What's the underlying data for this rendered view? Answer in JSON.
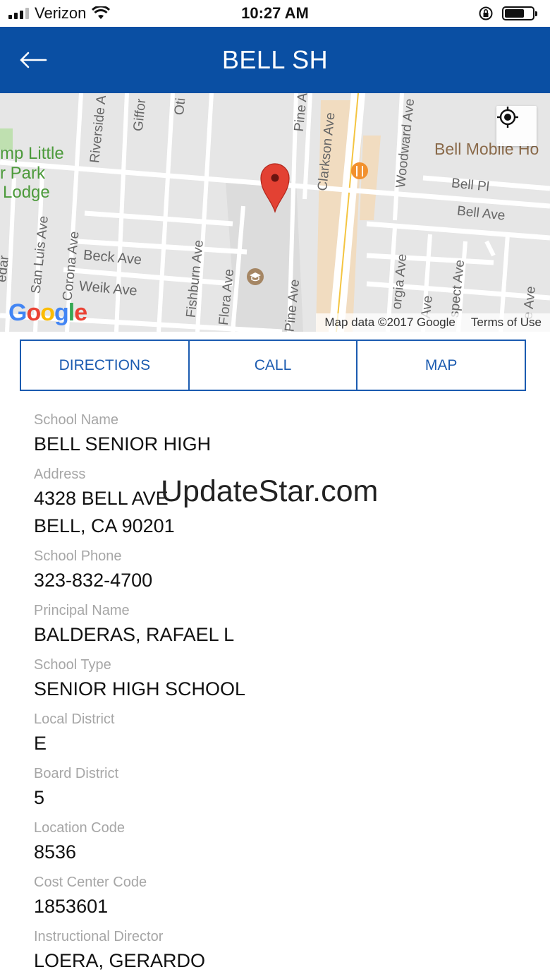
{
  "status_bar": {
    "carrier": "Verizon",
    "time": "10:27 AM"
  },
  "header": {
    "title": "BELL SH"
  },
  "map": {
    "attribution": "Map data ©2017 Google",
    "terms": "Terms of Use",
    "logo": "Google",
    "labels": {
      "park1": "mp Little",
      "park2": "r Park",
      "park3": "Lodge",
      "riverside": "Riverside A",
      "gifford": "Giffor",
      "otis": "Oti",
      "pine_top": "Pine A",
      "clarkson": "Clarkson Ave",
      "woodward": "Woodward Ave",
      "bell_mobile": "Bell Mobile Ho",
      "bell_pl": "Bell Pl",
      "bell_ave": "Bell Ave",
      "san_luis": "San Luis Ave",
      "corona": "Corona Ave",
      "beck": "Beck Ave",
      "weik": "Weik Ave",
      "fishburn": "Fishburn Ave",
      "flora": "Flora Ave",
      "pine_bottom": "Pine Ave",
      "georgia": "orgia Ave",
      "ave_small": "Ave",
      "prospect": "spect Ave",
      "e_ave": "e Ave",
      "cedar": "edar"
    }
  },
  "actions": {
    "directions": "DIRECTIONS",
    "call": "CALL",
    "map": "MAP"
  },
  "details": [
    {
      "label": "School Name",
      "value": "BELL SENIOR HIGH"
    },
    {
      "label": "Address",
      "value": "4328 BELL AVE",
      "value2": "BELL, CA 90201"
    },
    {
      "label": "School Phone",
      "value": "323-832-4700"
    },
    {
      "label": "Principal Name",
      "value": "BALDERAS, RAFAEL L"
    },
    {
      "label": "School Type",
      "value": "SENIOR HIGH SCHOOL"
    },
    {
      "label": "Local District",
      "value": "E"
    },
    {
      "label": "Board District",
      "value": "5"
    },
    {
      "label": "Location Code",
      "value": "8536"
    },
    {
      "label": "Cost Center Code",
      "value": "1853601"
    },
    {
      "label": "Instructional Director",
      "value": "LOERA, GERARDO"
    }
  ],
  "watermark": "UpdateStar.com",
  "colors": {
    "header_bg": "#0a4fa3",
    "accent": "#1b5bb0",
    "label_gray": "#a6a6a6",
    "pin_red": "#d93025"
  }
}
